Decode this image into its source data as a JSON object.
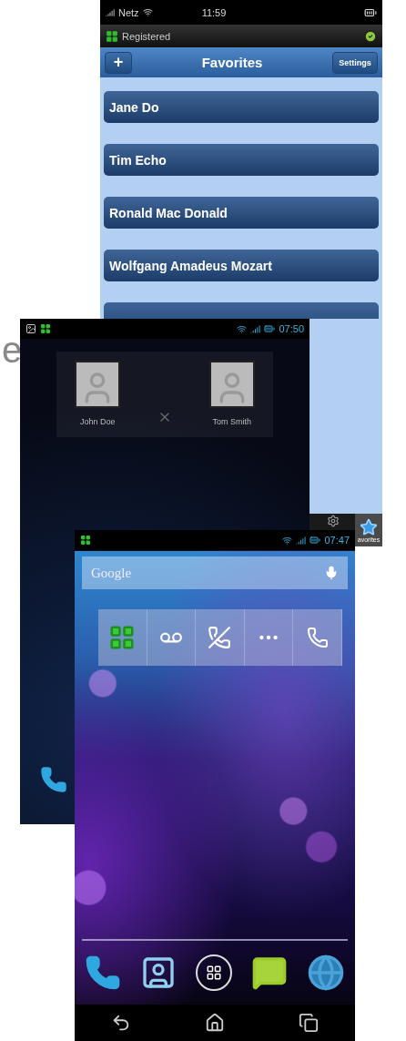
{
  "backdrop_fragment": "e",
  "ios_screen": {
    "status_bar": {
      "carrier": "Netz",
      "time": "11:59"
    },
    "registration": {
      "label": "Registered",
      "registered": true
    },
    "nav": {
      "add_label": "+",
      "title": "Favorites",
      "settings_label": "Settings"
    },
    "favorites": [
      {
        "name": "Jane Do"
      },
      {
        "name": "Tim Echo"
      },
      {
        "name": "Ronald Mac Donald"
      },
      {
        "name": "Wolfgang Amadeus Mozart"
      }
    ],
    "tab_bar": [
      {
        "kind": "settings",
        "selected": false
      },
      {
        "kind": "favorites",
        "label": "avorites",
        "selected": true
      }
    ]
  },
  "android_contacts": {
    "status_time": "07:50",
    "contacts": [
      {
        "name": "John Doe"
      },
      {
        "name": "Tom Smith"
      }
    ]
  },
  "android_home": {
    "status_time": "07:47",
    "search": {
      "placeholder": "Google"
    },
    "widget": [
      {
        "kind": "grid"
      },
      {
        "kind": "voicemail"
      },
      {
        "kind": "hangup"
      },
      {
        "kind": "more"
      },
      {
        "kind": "call"
      }
    ],
    "dock": [
      {
        "kind": "phone"
      },
      {
        "kind": "contacts"
      },
      {
        "kind": "apps"
      },
      {
        "kind": "messages"
      },
      {
        "kind": "browser"
      }
    ]
  }
}
